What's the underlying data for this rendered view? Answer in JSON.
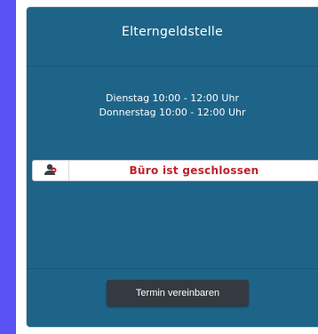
{
  "card": {
    "title": "Elterngeldstelle",
    "hours": [
      "Dienstag 10:00 - 12:00 Uhr",
      "Donnerstag 10:00 - 12:00 Uhr"
    ],
    "status": {
      "icon": "person-closed-icon",
      "text": "Büro ist geschlossen",
      "color": "#c0202a"
    },
    "button_label": "Termin vereinbaren"
  },
  "colors": {
    "background": "#5a52f2",
    "card": "#1e6489",
    "button": "#343a40"
  }
}
